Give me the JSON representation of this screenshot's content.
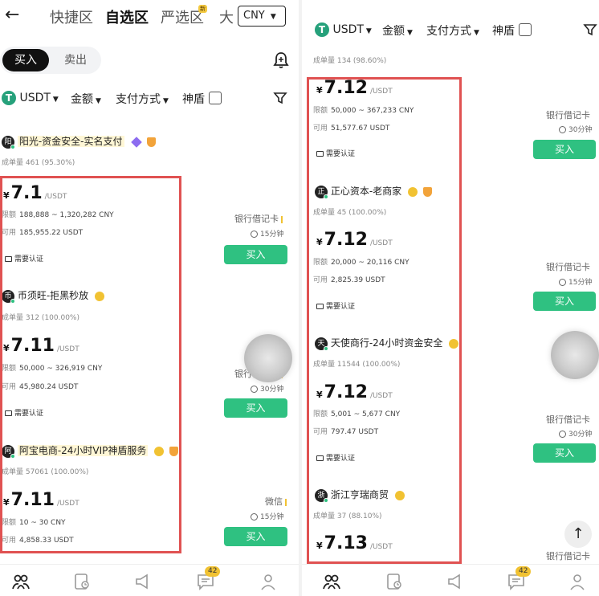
{
  "left_panel": {
    "back_label": "←",
    "nav_tabs": [
      "快捷区",
      "自选区",
      "严选区",
      "大"
    ],
    "new_badge": "新",
    "currency_select": "CNY",
    "buy_tab": "买入",
    "sell_tab": "卖出",
    "filters": {
      "coin": "USDT",
      "amount": "金额",
      "payment": "支付方式",
      "shield": "神盾",
      "coin_logo": "T"
    },
    "top_merchant": {
      "name": "阳光-资金安全-实名支付",
      "avatar": "阳",
      "stat_label": "成单量",
      "stat_value": "461 (95.30%)"
    },
    "offers": [
      {
        "price_symbol": "¥",
        "price": "7.1",
        "unit": "/USDT",
        "limit_label": "限额",
        "limit": "188,888 ~ 1,320,282 CNY",
        "avail_label": "可用",
        "avail": "185,955.22 USDT",
        "verify": "需要认证",
        "payment": "银行借记卡",
        "time": "15分钟",
        "button": "买入"
      },
      {
        "merchant": "币须旺-拒黑秒放",
        "avatar": "币",
        "stat_label": "成单量",
        "stat_value": "312 (100.00%)",
        "price_symbol": "¥",
        "price": "7.11",
        "unit": "/USDT",
        "limit_label": "限额",
        "limit": "50,000 ~ 326,919 CNY",
        "avail_label": "可用",
        "avail": "45,980.24 USDT",
        "verify": "需要认证",
        "payment": "银行借记卡",
        "time": "30分钟",
        "button": "买入"
      },
      {
        "merchant": "阿宝电商-24小时VIP神盾服务",
        "avatar": "阿",
        "stat_label": "成单量",
        "stat_value": "57061 (100.00%)",
        "price_symbol": "¥",
        "price": "7.11",
        "unit": "/USDT",
        "limit_label": "限额",
        "limit": "10 ~ 30 CNY",
        "avail_label": "可用",
        "avail": "4,858.33 USDT",
        "payment": "微信",
        "time": "15分钟",
        "button": "买入"
      }
    ],
    "bottom_nav": {
      "message_count": "42"
    }
  },
  "right_panel": {
    "filters": {
      "coin": "USDT",
      "amount": "金额",
      "payment": "支付方式",
      "shield": "神盾",
      "coin_logo": "T"
    },
    "top_stat": {
      "label": "成单量",
      "value": "134 (98.60%)"
    },
    "offers": [
      {
        "price_symbol": "¥",
        "price": "7.12",
        "unit": "/USDT",
        "limit_label": "限额",
        "limit": "50,000 ~ 367,233 CNY",
        "avail_label": "可用",
        "avail": "51,577.67 USDT",
        "verify": "需要认证",
        "payment": "银行借记卡",
        "time": "30分钟",
        "button": "买入"
      },
      {
        "merchant": "正心资本-老商家",
        "avatar": "正",
        "stat_label": "成单量",
        "stat_value": "45 (100.00%)",
        "price_symbol": "¥",
        "price": "7.12",
        "unit": "/USDT",
        "limit_label": "限额",
        "limit": "20,000 ~ 20,116 CNY",
        "avail_label": "可用",
        "avail": "2,825.39 USDT",
        "verify": "需要认证",
        "payment": "银行借记卡",
        "time": "15分钟",
        "button": "买入"
      },
      {
        "merchant": "天使商行-24小时资金安全",
        "avatar": "天",
        "stat_label": "成单量",
        "stat_value": "11544 (100.00%)",
        "price_symbol": "¥",
        "price": "7.12",
        "unit": "/USDT",
        "limit_label": "限额",
        "limit": "5,001 ~ 5,677 CNY",
        "avail_label": "可用",
        "avail": "797.47 USDT",
        "verify": "需要认证",
        "payment": "银行借记卡",
        "time": "30分钟",
        "button": "买入"
      },
      {
        "merchant": "浙江亨瑞商贸",
        "avatar": "浙",
        "stat_label": "成单量",
        "stat_value": "37 (88.10%)",
        "price_symbol": "¥",
        "price": "7.13",
        "unit": "/USDT",
        "payment": "银行借记卡"
      }
    ],
    "scroll_top_label": "↑",
    "bottom_nav": {
      "message_count": "42"
    }
  },
  "colors": {
    "accent_green": "#2fc181",
    "highlight_red": "#e05252",
    "badge_gold": "#f1c232",
    "usdt_green": "#26a17b"
  }
}
